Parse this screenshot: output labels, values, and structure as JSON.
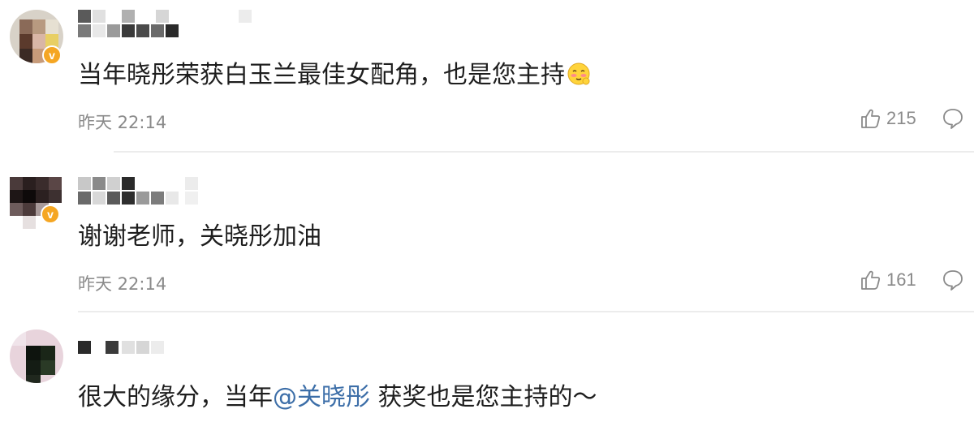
{
  "comments": [
    {
      "text": "当年晓彤荣获白玉兰最佳女配角，也是您主持",
      "emoji": "blushing-face-emoji",
      "time": "昨天 22:14",
      "likes": "215",
      "verified_badge": "v"
    },
    {
      "text": "谢谢老师，关晓彤加油",
      "time": "昨天 22:14",
      "likes": "161",
      "verified_badge": "v"
    },
    {
      "text_before": "很大的缘分，当年",
      "mention": "@关晓彤",
      "text_after": " 获奖也是您主持的～"
    }
  ],
  "icons": {
    "like": "thumbs-up-icon",
    "reply": "speech-bubble-icon"
  },
  "colors": {
    "mention": "#3c6ea8",
    "meta": "#8a8a8a",
    "badge": "#f5a623",
    "divider": "#ececec"
  }
}
